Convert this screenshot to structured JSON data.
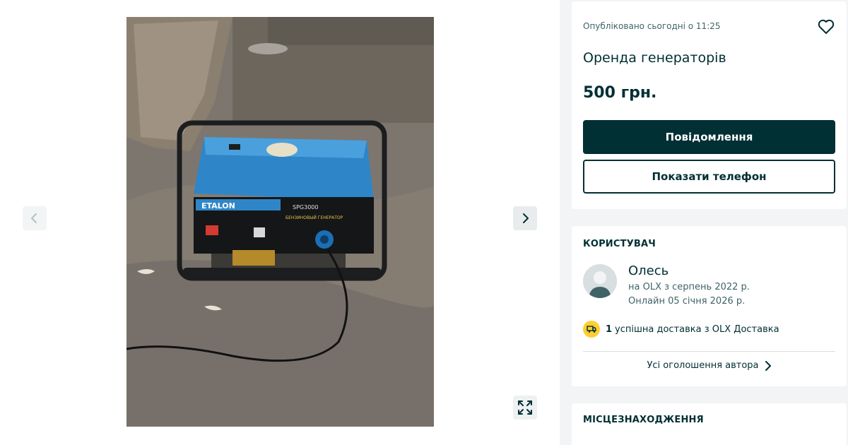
{
  "listing": {
    "published": "Опубліковано сьогодні о 11:25",
    "title": "Оренда генераторів",
    "price": "500 грн.",
    "message_button": "Повідомлення",
    "phone_button": "Показати телефон"
  },
  "user": {
    "section_title": "КОРИСТУВАЧ",
    "name": "Олесь",
    "since": "на OLX з серпень 2022 р.",
    "online": "Онлайн 05 січня 2026 р.",
    "delivery_count": "1",
    "delivery_text": "успішна доставка з OLX Доставка",
    "all_ads": "Усі оголошення автора"
  },
  "location": {
    "section_title": "МІСЦЕЗНАХОДЖЕННЯ"
  },
  "photo": {
    "brand": "ETALON",
    "model": "SPG3000",
    "subtitle": "БЕНЗИНОВЫЙ ГЕНЕРАТОР"
  },
  "icons": {
    "prev": "chevron-left-icon",
    "next": "chevron-right-icon",
    "expand": "expand-icon",
    "favorite": "heart-icon",
    "delivery": "truck-icon"
  },
  "colors": {
    "primary": "#002f34",
    "muted": "#406367",
    "delivery_badge": "#ffce32",
    "background": "#f2f4f5"
  }
}
